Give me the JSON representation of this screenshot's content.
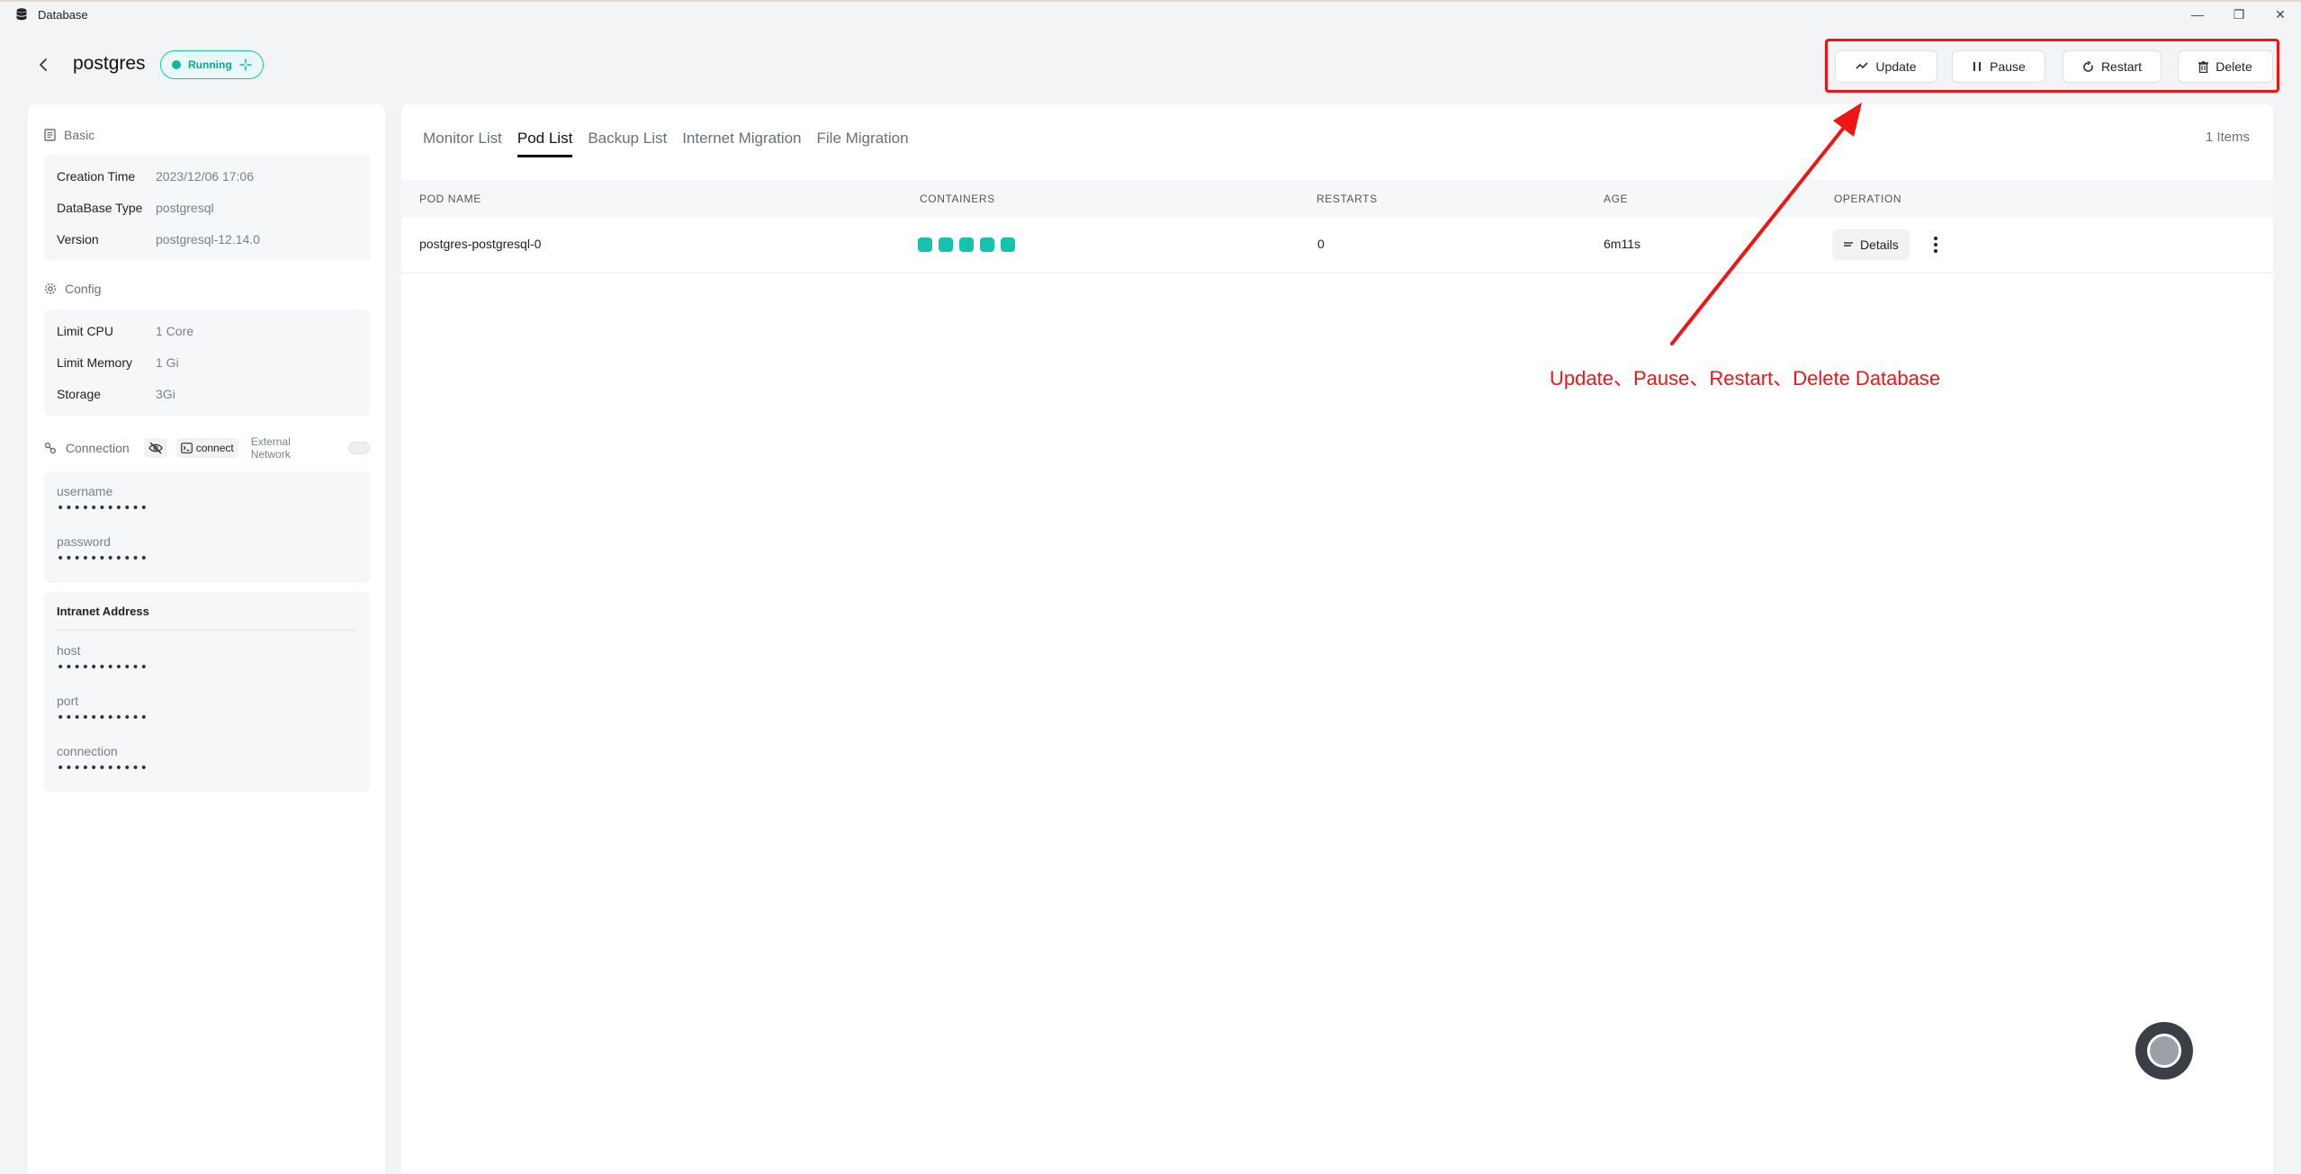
{
  "window": {
    "title": "Database",
    "minimize_glyph": "—",
    "restore_glyph": "❐",
    "close_glyph": "✕"
  },
  "header": {
    "db_name": "postgres",
    "status": "Running",
    "actions": {
      "update": "Update",
      "pause": "Pause",
      "restart": "Restart",
      "delete": "Delete"
    }
  },
  "basic": {
    "title": "Basic",
    "rows": [
      {
        "key": "Creation Time",
        "value": "2023/12/06 17:06"
      },
      {
        "key": "DataBase Type",
        "value": "postgresql"
      },
      {
        "key": "Version",
        "value": "postgresql-12.14.0"
      }
    ]
  },
  "config": {
    "title": "Config",
    "rows": [
      {
        "key": "Limit CPU",
        "value": "1 Core"
      },
      {
        "key": "Limit Memory",
        "value": "1 Gi"
      },
      {
        "key": "Storage",
        "value": "3Gi"
      }
    ]
  },
  "connection": {
    "title": "Connection",
    "connect_label": "connect",
    "external_network_label": "External Network",
    "external_network_enabled": false,
    "username_label": "username",
    "username_value": "•••••••••••",
    "password_label": "password",
    "password_value": "•••••••••••"
  },
  "intranet": {
    "title": "Intranet Address",
    "host_label": "host",
    "host_value": "•••••••••••",
    "port_label": "port",
    "port_value": "•••••••••••",
    "connection_label": "connection",
    "connection_value": "•••••••••••"
  },
  "main": {
    "tabs": [
      {
        "label": "Monitor List",
        "active": false
      },
      {
        "label": "Pod List",
        "active": true
      },
      {
        "label": "Backup List",
        "active": false
      },
      {
        "label": "Internet Migration",
        "active": false
      },
      {
        "label": "File Migration",
        "active": false
      }
    ],
    "items_count": "1 Items",
    "columns": {
      "pod_name": "POD NAME",
      "containers": "CONTAINERS",
      "restarts": "RESTARTS",
      "age": "AGE",
      "operation": "OPERATION"
    },
    "rows": [
      {
        "pod_name": "postgres-postgresql-0",
        "containers_count": 5,
        "restarts": "0",
        "age": "6m11s",
        "details_label": "Details"
      }
    ]
  },
  "annotation": {
    "text": "Update、Pause、Restart、Delete Database",
    "color": "#f01515"
  },
  "colors": {
    "accent": "#14c2ae",
    "status_border": "#1fbfae",
    "annotation_red": "#f01515"
  }
}
